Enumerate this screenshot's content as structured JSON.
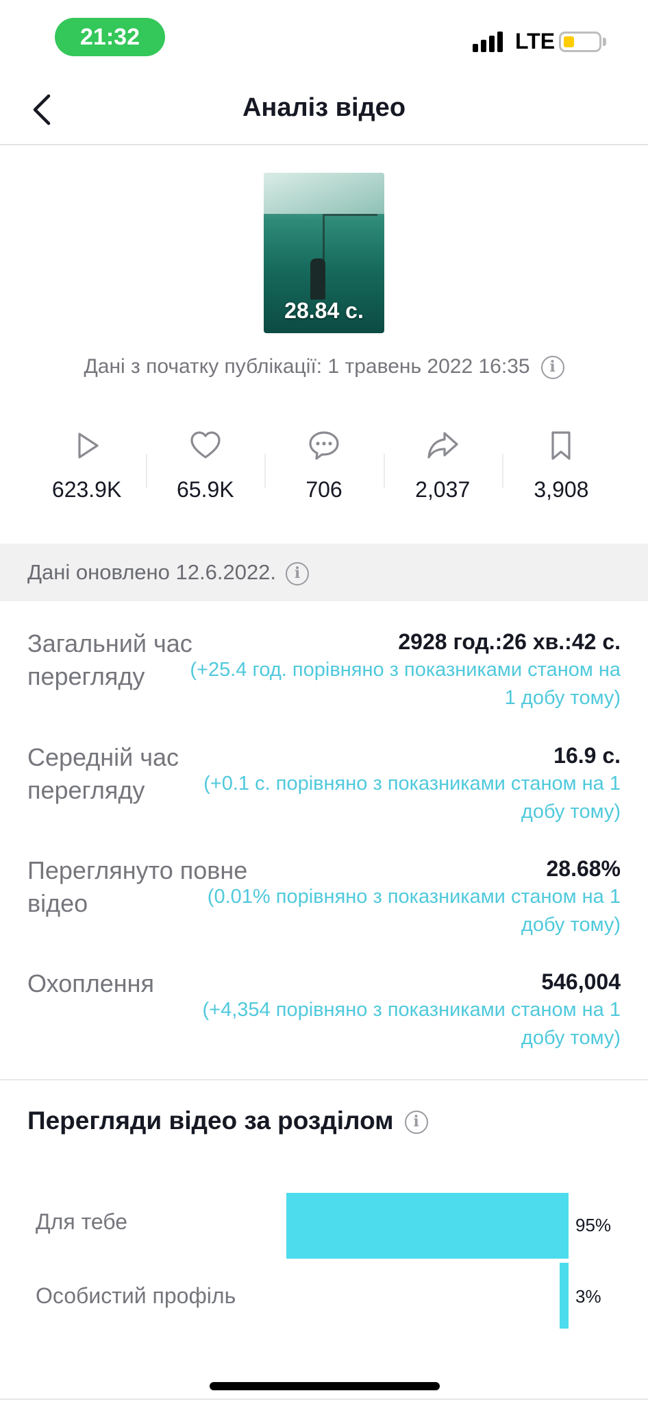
{
  "status_bar": {
    "time": "21:32",
    "network": "LTE",
    "battery_level": 0.3
  },
  "header": {
    "title": "Аналіз відео"
  },
  "video": {
    "duration": "28.84 с.",
    "published_label": "Дані з початку публікації: 1 травень 2022 16:35"
  },
  "stats": [
    {
      "icon": "play-icon",
      "value": "623.9K"
    },
    {
      "icon": "heart-icon",
      "value": "65.9K"
    },
    {
      "icon": "comment-icon",
      "value": "706"
    },
    {
      "icon": "share-icon",
      "value": "2,037"
    },
    {
      "icon": "bookmark-icon",
      "value": "3,908"
    }
  ],
  "updated_banner": {
    "text": "Дані оновлено 12.6.2022."
  },
  "metrics": [
    {
      "label": "Загальний час перегляду",
      "value": "2928 год.:26 хв.:42 с.",
      "delta": "(+25.4 год. порівняно з показниками станом на 1 добу тому)"
    },
    {
      "label": "Середній час перегляду",
      "value": "16.9 с.",
      "delta": "(+0.1 с. порівняно з показниками станом на 1 добу тому)"
    },
    {
      "label": "Переглянуто повне відео",
      "value": "28.68%",
      "delta": "(0.01% порівняно з показниками станом на 1 добу тому)"
    },
    {
      "label": "Охоплення",
      "value": "546,004",
      "delta": "(+4,354 порівняно з показниками станом на 1 добу тому)"
    }
  ],
  "sections_chart": {
    "title": "Перегляди відео за розділом",
    "bars": [
      {
        "label": "Для тебе",
        "percent_label": "95%",
        "value": 95
      },
      {
        "label": "Особистий профіль",
        "percent_label": "3%",
        "value": 3
      }
    ]
  },
  "colors": {
    "accent": "#4fc9dc",
    "bar": "#4cdcee",
    "time_pill": "#34c759",
    "battery": "#ffcc00",
    "text_primary": "#161823",
    "text_secondary": "#75767c"
  }
}
